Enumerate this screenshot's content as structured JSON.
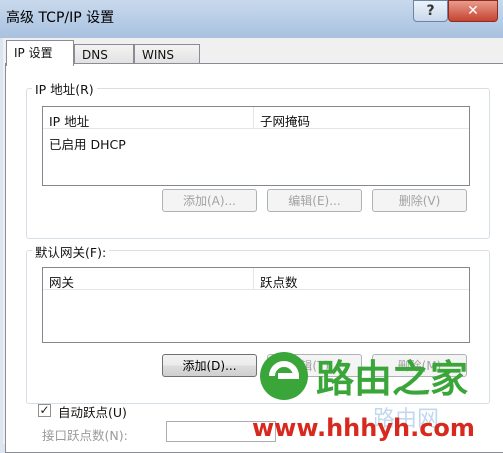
{
  "window": {
    "title": "高级 TCP/IP 设置",
    "help_glyph": "?",
    "close_glyph": "✕"
  },
  "tabs": [
    {
      "label": "IP 设置",
      "active": true
    },
    {
      "label": "DNS",
      "active": false
    },
    {
      "label": "WINS",
      "active": false
    }
  ],
  "ip_group": {
    "label": "IP 地址(R)",
    "columns": [
      "IP 地址",
      "子网掩码"
    ],
    "rows": [
      {
        "ip": "已启用 DHCP",
        "mask": ""
      }
    ],
    "buttons": {
      "add": "添加(A)...",
      "edit": "编辑(E)...",
      "delete": "删除(V)"
    }
  },
  "gateway_group": {
    "label": "默认网关(F):",
    "columns": [
      "网关",
      "跃点数"
    ],
    "buttons": {
      "add": "添加(D)...",
      "edit": "编辑(T)...",
      "delete": "删除(M)"
    }
  },
  "metric": {
    "auto_label": "自动跃点(U)",
    "auto_checked": true,
    "check_glyph": "✓",
    "interface_label": "接口跃点数(N):",
    "interface_value": ""
  },
  "watermark": {
    "brand": "路由之家",
    "url": "www.hhhyh.com",
    "faint_text": "路由网",
    "accent_green": "#3aa63a",
    "accent_red": "#d8291f"
  }
}
